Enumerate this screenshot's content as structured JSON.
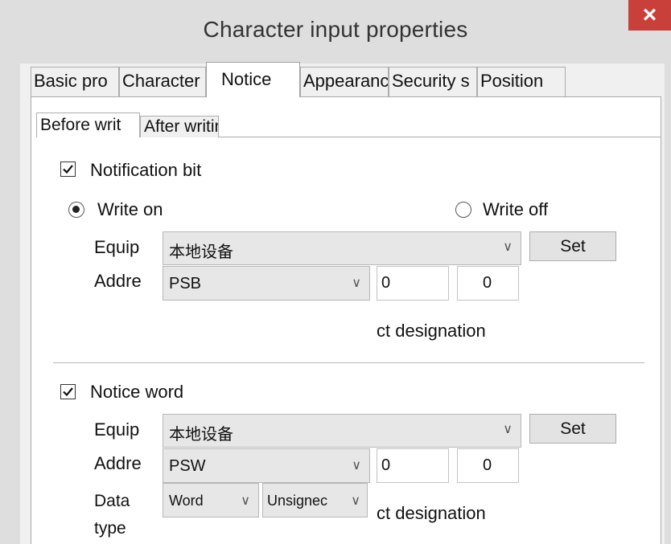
{
  "window": {
    "title": "Character input properties",
    "close_glyph": "×"
  },
  "tabs": [
    {
      "label": "Basic pro"
    },
    {
      "label": "Character"
    },
    {
      "label": "Notice"
    },
    {
      "label": "Appearance"
    },
    {
      "label": "Security s"
    },
    {
      "label": "Position"
    }
  ],
  "subtabs": [
    {
      "label": "Before writ"
    },
    {
      "label": "After writing"
    }
  ],
  "notification_bit": {
    "checkbox_label": "Notification bit",
    "checked": true,
    "write_on_label": "Write on",
    "write_off_label": "Write off",
    "equip_label": "Equip",
    "equip_value": "本地设备",
    "set_label": "Set",
    "addr_label": "Addre",
    "addr_type": "PSB",
    "addr_field1": "0",
    "addr_field2": "0",
    "designation_text": "ct designation"
  },
  "notice_word": {
    "checkbox_label": "Notice word",
    "checked": true,
    "equip_label": "Equip",
    "equip_value": "本地设备",
    "set_label": "Set",
    "addr_label": "Addre",
    "addr_type": "PSW",
    "addr_field1": "0",
    "addr_field2": "0",
    "data_label_line1": "Data",
    "data_label_line2": "type",
    "data_word": "Word",
    "data_sign": "Unsignec",
    "designation_text": "ct designation"
  },
  "icons": {
    "chevron": "∨",
    "check": "check-icon",
    "radio": "radio-icon"
  },
  "colors": {
    "close_bg": "#c9403b",
    "title_bg": "#dedede",
    "panel_bg": "#f0f0f0"
  }
}
